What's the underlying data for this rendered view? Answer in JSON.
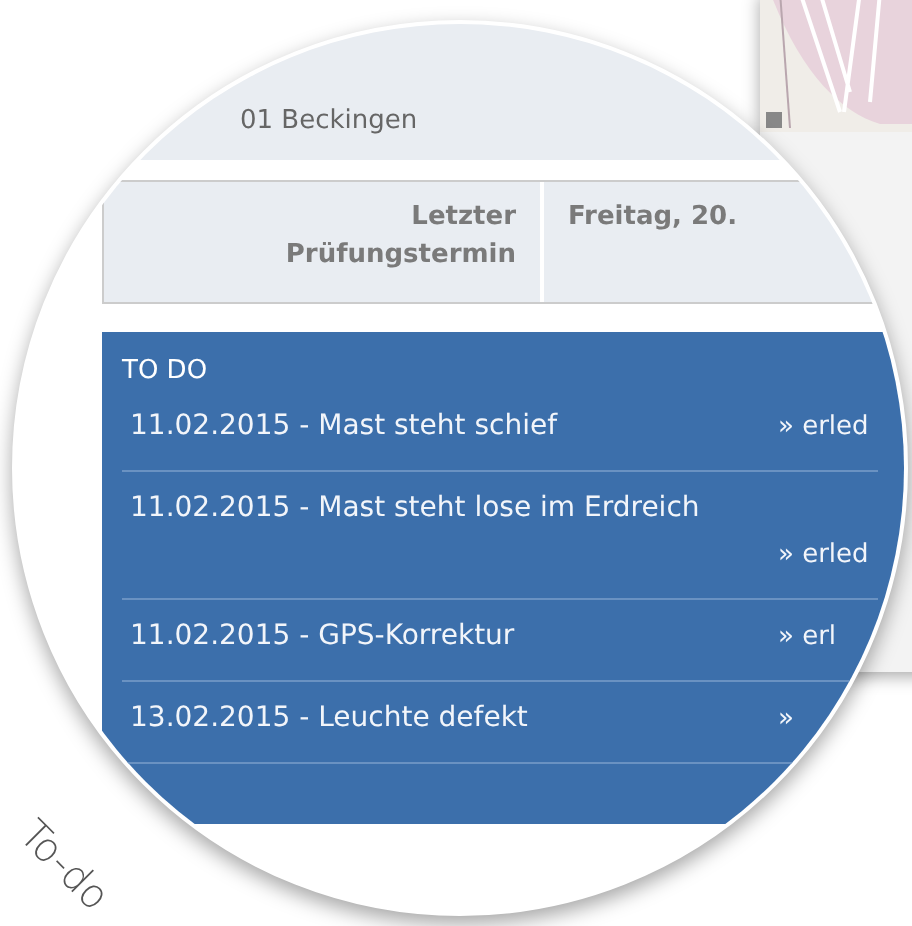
{
  "address": "01 Beckingen",
  "info_row": {
    "label": "Letzter Prüfungstermin",
    "value": "Freitag, 20. "
  },
  "todo": {
    "title": "TO DO",
    "items": [
      {
        "text": "11.02.2015 - Mast steht schief",
        "action": "» erled"
      },
      {
        "text": "11.02.2015 - Mast steht lose im Erdreich",
        "action": "» erled"
      },
      {
        "text": "11.02.2015 - GPS-Korrektur",
        "action": "» erl"
      },
      {
        "text": "13.02.2015 - Leuchte defekt",
        "action": "»"
      }
    ]
  },
  "caption": "To-do"
}
